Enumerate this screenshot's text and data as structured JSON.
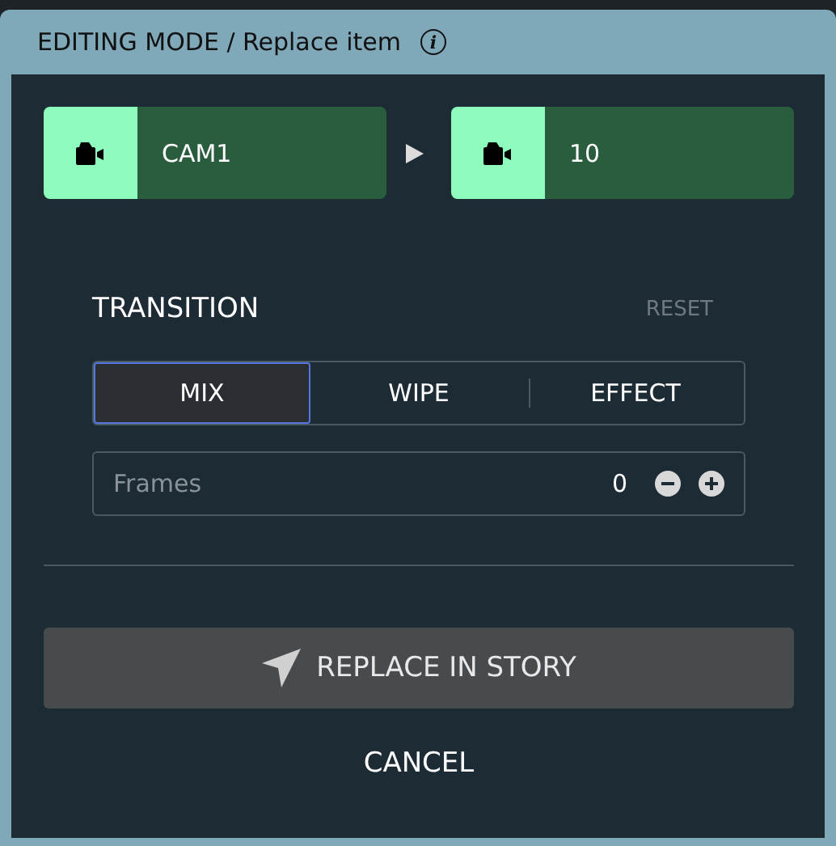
{
  "window": {
    "title": "EDITING MODE / Replace item",
    "info_icon": "i"
  },
  "sources": [
    {
      "label": "CAM1"
    },
    {
      "label": "10"
    }
  ],
  "transition": {
    "title": "TRANSITION",
    "reset": "RESET",
    "tabs": [
      {
        "label": "MIX",
        "selected": true
      },
      {
        "label": "WIPE",
        "selected": false
      },
      {
        "label": "EFFECT",
        "selected": false
      }
    ],
    "frames": {
      "placeholder": "Frames",
      "value": "0"
    }
  },
  "buttons": {
    "replace": "REPLACE IN STORY",
    "cancel": "CANCEL"
  }
}
